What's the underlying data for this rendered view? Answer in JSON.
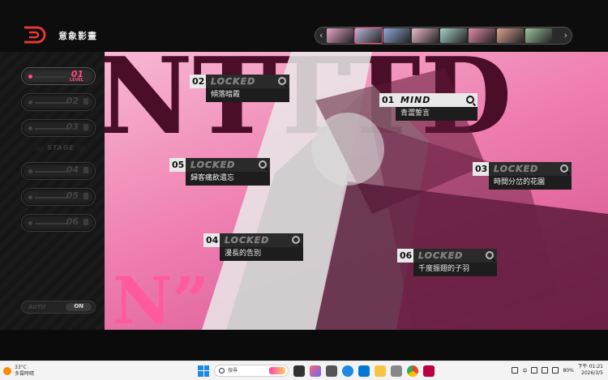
{
  "app": {
    "title": "意象影畫"
  },
  "colors": {
    "accent": "#ff4b7d",
    "background": "#0b0b0b"
  },
  "character_strip": {
    "portraits": [
      "#e8a4c8",
      "#b9b6d8",
      "#8fa8d6",
      "#e9b9c8",
      "#a7d0c8",
      "#e08aa8",
      "#d9a18f",
      "#9cc29a"
    ],
    "selected_index": 1
  },
  "sidebar": {
    "stages": [
      {
        "num": "01",
        "sub": "LEVEL",
        "active": true
      },
      {
        "num": "02",
        "active": false
      },
      {
        "num": "03",
        "active": false
      },
      {
        "num": "04",
        "active": false
      },
      {
        "num": "05",
        "active": false
      },
      {
        "num": "06",
        "active": false
      }
    ],
    "stage_label": "STAGE",
    "toggle": {
      "label": "AUTO",
      "value": "ON"
    }
  },
  "cards": [
    {
      "num": "01",
      "head": "MIND",
      "title": "青澀誓言",
      "unlocked": true
    },
    {
      "num": "02",
      "head": "LOCKED",
      "title": "傾落暗霞",
      "unlocked": false
    },
    {
      "num": "03",
      "head": "LOCKED",
      "title": "時間分岔的花園",
      "unlocked": false
    },
    {
      "num": "04",
      "head": "LOCKED",
      "title": "漫長的告別",
      "unlocked": false
    },
    {
      "num": "05",
      "head": "LOCKED",
      "title": "歸客痛飲遺忘",
      "unlocked": false
    },
    {
      "num": "06",
      "head": "LOCKED",
      "title": "千度振翅的子羽",
      "unlocked": false
    }
  ],
  "taskbar": {
    "weather_temp": "33°C",
    "weather_desc": "多雲時晴",
    "search_placeholder": "搜尋",
    "tray": {
      "lang": "中",
      "battery": "80%",
      "time": "下午 01:21",
      "date": "2026/3/5"
    }
  }
}
